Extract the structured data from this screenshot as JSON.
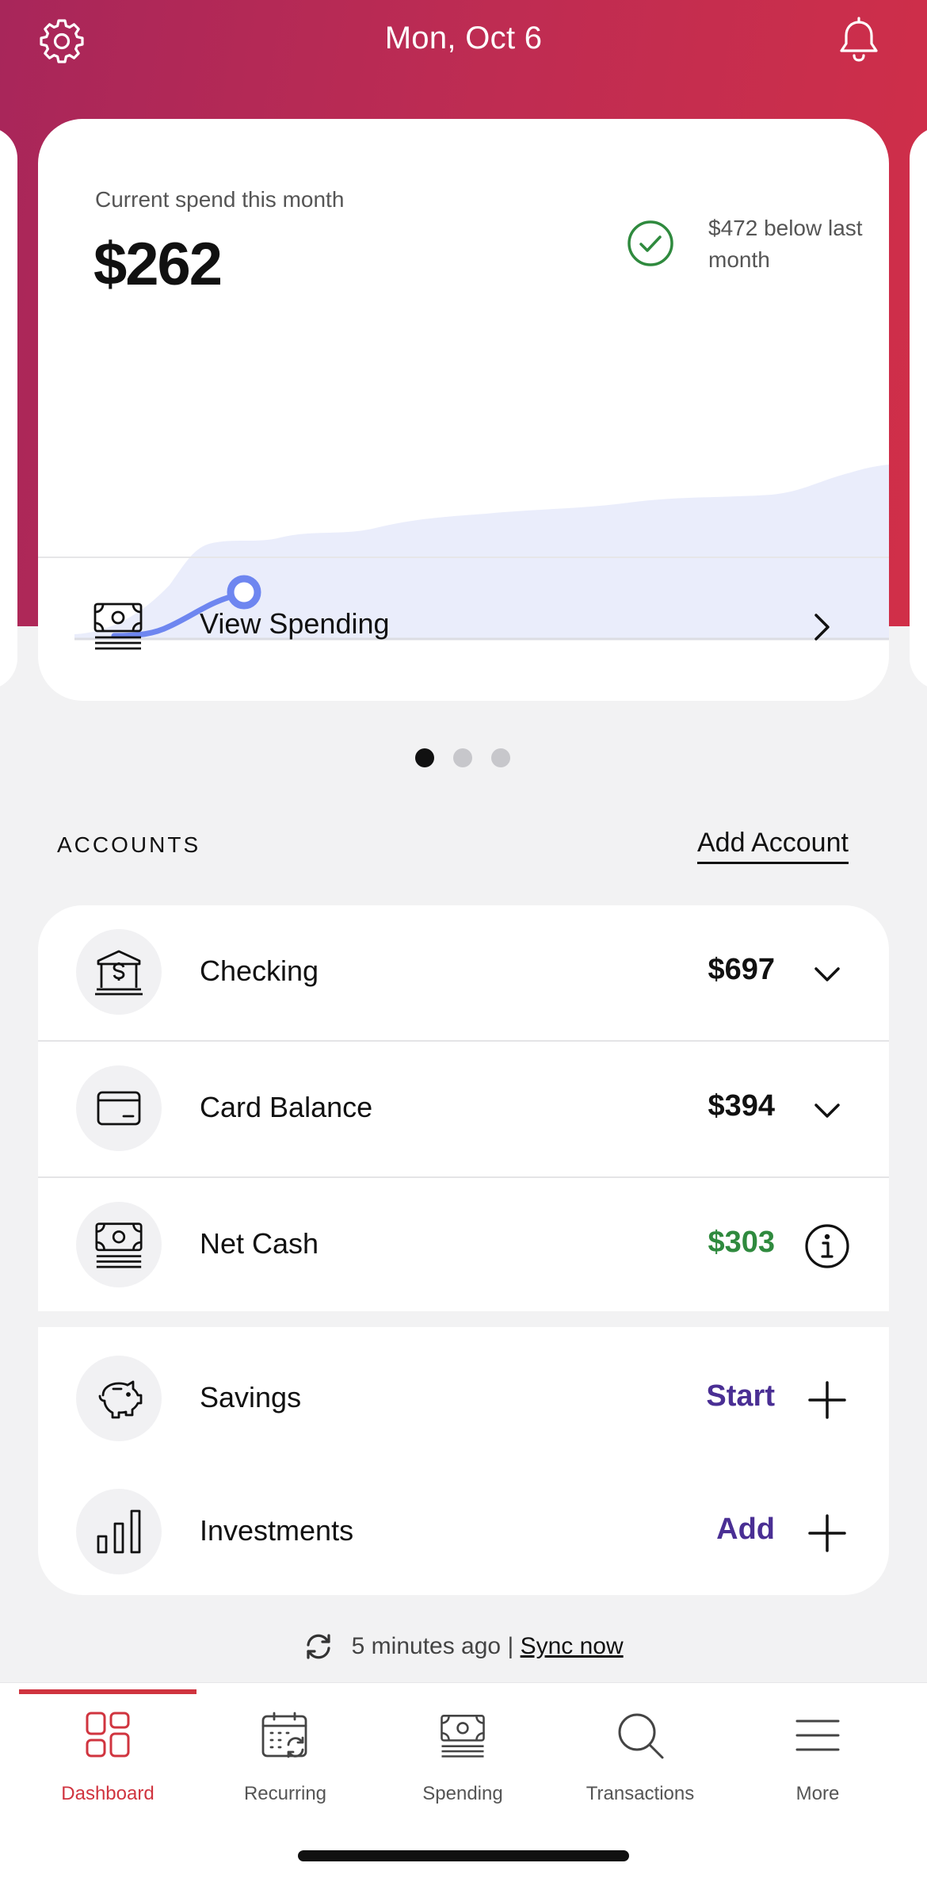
{
  "header": {
    "date": "Mon, Oct 6"
  },
  "spend": {
    "label": "Current spend this month",
    "amount": "$262",
    "comparison": "$472 below last month",
    "view_label": "View Spending"
  },
  "pager": {
    "pages": 3,
    "active": 0
  },
  "accounts": {
    "title": "ACCOUNTS",
    "add_label": "Add Account",
    "items": [
      {
        "name": "Checking",
        "value": "$697",
        "icon": "bank-icon",
        "trail": "chevron-down-icon"
      },
      {
        "name": "Card Balance",
        "value": "$394",
        "icon": "card-icon",
        "trail": "chevron-down-icon"
      },
      {
        "name": "Net Cash",
        "value": "$303",
        "icon": "cash-icon",
        "trail": "info-icon",
        "color": "#2f8a3e"
      }
    ],
    "growth": [
      {
        "name": "Savings",
        "action": "Start",
        "icon": "piggy-bank-icon",
        "trail": "plus-icon"
      },
      {
        "name": "Investments",
        "action": "Add",
        "icon": "bar-chart-icon",
        "trail": "plus-icon"
      }
    ]
  },
  "sync": {
    "status": "5 minutes ago |",
    "link": "Sync now"
  },
  "tabs": [
    {
      "label": "Dashboard",
      "icon": "dashboard-icon",
      "active": true
    },
    {
      "label": "Recurring",
      "icon": "calendar-icon",
      "active": false
    },
    {
      "label": "Spending",
      "icon": "cash-icon",
      "active": false
    },
    {
      "label": "Transactions",
      "icon": "search-icon",
      "active": false
    },
    {
      "label": "More",
      "icon": "menu-icon",
      "active": false
    }
  ],
  "colors": {
    "brand": "#c62d4f",
    "active_tab": "#d0343f",
    "positive": "#2f8a3e",
    "action": "#4a2f94",
    "chart_line": "#6e86f0",
    "chart_fill": "#eaedfb"
  }
}
